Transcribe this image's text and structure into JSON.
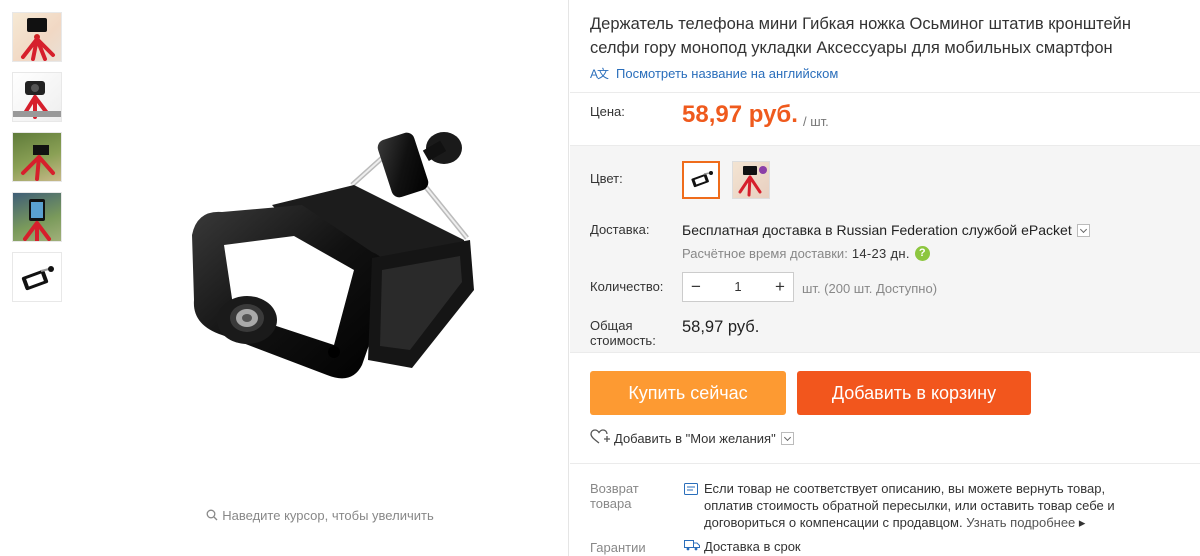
{
  "product": {
    "title": "Держатель телефона мини Гибкая ножка Осьминог штатив кронштейн селфи гору монопод укладки Аксессуары для мобильных смартфон",
    "translate_link": "Посмотреть название на английском"
  },
  "gallery": {
    "thumbnails": [
      "thumbnail-1",
      "thumbnail-2",
      "thumbnail-3",
      "thumbnail-4",
      "thumbnail-5"
    ],
    "zoom_hint": "Наведите курсор, чтобы увеличить"
  },
  "price": {
    "label": "Цена:",
    "value": "58,97 руб.",
    "unit": "/ шт."
  },
  "color": {
    "label": "Цвет:",
    "selected_index": 0
  },
  "shipping": {
    "label": "Доставка:",
    "text": "Бесплатная доставка в Russian Federation службой ePacket",
    "eta_label": "Расчётное время доставки:",
    "eta_days": "14-23 дн."
  },
  "quantity": {
    "label": "Количество:",
    "minus": "−",
    "value": "1",
    "plus": "+",
    "available": "шт. (200 шт. Доступно)"
  },
  "total": {
    "label": "Общая стоимость:",
    "value": "58,97 руб."
  },
  "actions": {
    "buy_now": "Купить сейчас",
    "add_to_cart": "Добавить в корзину",
    "wishlist": "Добавить в \"Мои желания\""
  },
  "returns": {
    "label": "Возврат товара",
    "text": "Если товар не соответствует описанию, вы можете вернуть товар, оплатив стоимость обратной пересылки, или оставить товар себе и договориться о компенсации с продавцом.",
    "more": "Узнать подробнее"
  },
  "guarantee": {
    "label": "Гарантии",
    "text": "Доставка в срок"
  },
  "colors": {
    "accent_orange": "#ef5a1d",
    "buy_button": "#fd9a32",
    "cart_button": "#f2561d",
    "link_blue": "#2a6ebb"
  }
}
